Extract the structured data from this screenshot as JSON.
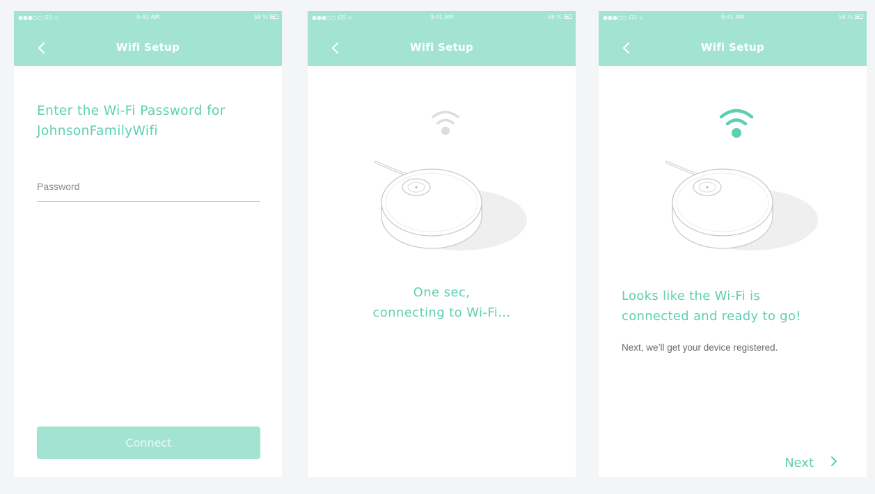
{
  "status_bar": {
    "carrier": "●●●○○ GS ᯤ",
    "time": "9:41 AM",
    "battery": "58 %"
  },
  "header": {
    "title": "Wifi Setup",
    "back_icon": "chevron-left-icon"
  },
  "screens": {
    "password": {
      "prompt_line1": "Enter the Wi-Fi Password for",
      "prompt_line2": "JohnsonFamilyWifi",
      "password_placeholder": "Password",
      "connect_label": "Connect"
    },
    "connecting": {
      "line1": "One sec,",
      "line2": "connecting to Wi-Fi…"
    },
    "connected": {
      "title_line1": "Looks like the Wi-Fi is",
      "title_line2": "connected and ready to go!",
      "subtitle": "Next, we’ll get your device registered.",
      "next_label": "Next"
    }
  },
  "colors": {
    "accent": "#a2e4d1",
    "accent_text": "#5ecfb2",
    "background": "#f4f5f6",
    "wifi_inactive": "#dcdcdc",
    "wifi_active": "#5ecfb2"
  }
}
